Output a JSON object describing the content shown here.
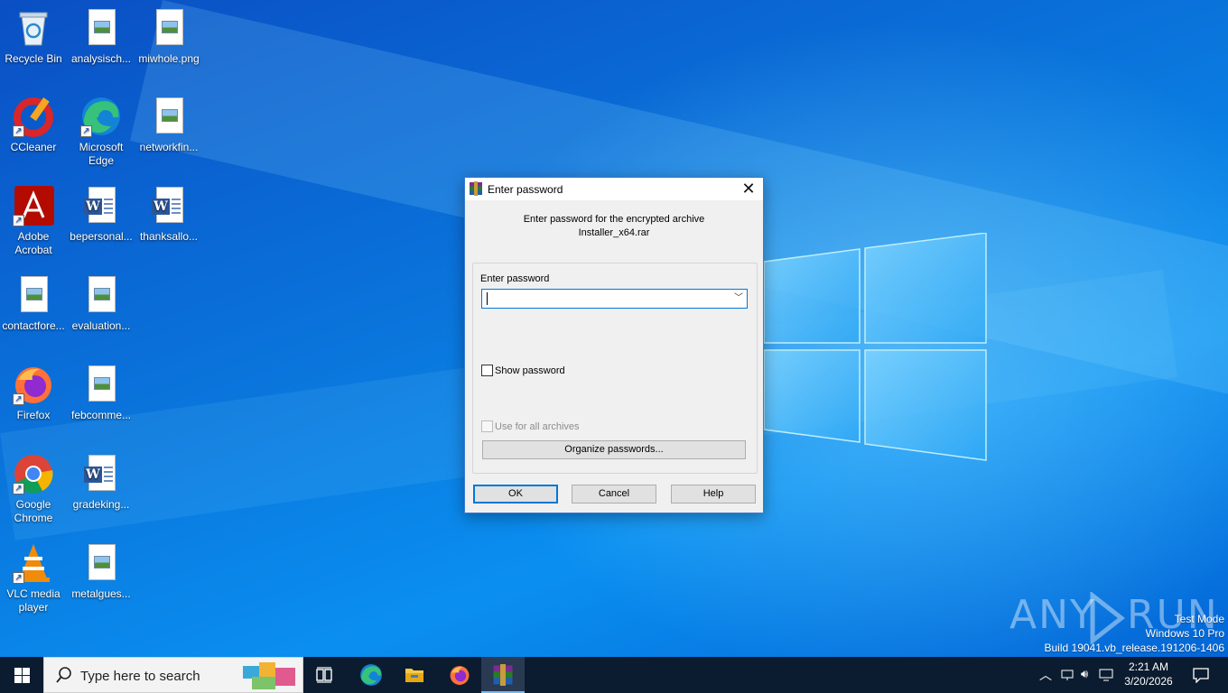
{
  "desktop": {
    "icons": [
      {
        "label": "Recycle Bin",
        "icon": "recycle-bin-icon"
      },
      {
        "label": "analysisch...",
        "icon": "image-file-icon"
      },
      {
        "label": "miwhole.png",
        "icon": "image-file-icon"
      },
      {
        "label": "CCleaner",
        "icon": "ccleaner-icon"
      },
      {
        "label": "Microsoft Edge",
        "icon": "edge-icon"
      },
      {
        "label": "networkfin...",
        "icon": "image-file-icon"
      },
      {
        "label": "Adobe Acrobat",
        "icon": "acrobat-icon"
      },
      {
        "label": "bepersonal...",
        "icon": "word-doc-icon"
      },
      {
        "label": "thanksallo...",
        "icon": "word-doc-icon"
      },
      {
        "label": "contactfore...",
        "icon": "image-file-icon"
      },
      {
        "label": "evaluation...",
        "icon": "image-file-icon"
      },
      {
        "label": "Firefox",
        "icon": "firefox-icon"
      },
      {
        "label": "febcomme...",
        "icon": "image-file-icon"
      },
      {
        "label": "Google Chrome",
        "icon": "chrome-icon"
      },
      {
        "label": "gradeking...",
        "icon": "word-doc-icon"
      },
      {
        "label": "VLC media player",
        "icon": "vlc-icon"
      },
      {
        "label": "metalgues...",
        "icon": "image-file-icon"
      }
    ]
  },
  "dialog": {
    "title": "Enter password",
    "prompt_line1": "Enter password for the encrypted archive",
    "prompt_line2": "Installer_x64.rar",
    "field_label": "Enter password",
    "password_value": "",
    "show_password_label": "Show password",
    "show_password_checked": false,
    "use_all_label": "Use for all archives",
    "use_all_checked": false,
    "organize_label": "Organize passwords...",
    "ok_label": "OK",
    "cancel_label": "Cancel",
    "help_label": "Help"
  },
  "watermark": {
    "left": "ANY",
    "right": "RUN"
  },
  "system": {
    "test_mode": "Test Mode",
    "os_name": "Windows 10 Pro",
    "build": "Build 19041.vb_release.191206-1406"
  },
  "taskbar": {
    "search_placeholder": "Type here to search",
    "time": "2:21 AM",
    "date": "3/20/2026",
    "colors": {
      "taskbar": "#0c1c30",
      "accent": "#0078d7"
    }
  }
}
